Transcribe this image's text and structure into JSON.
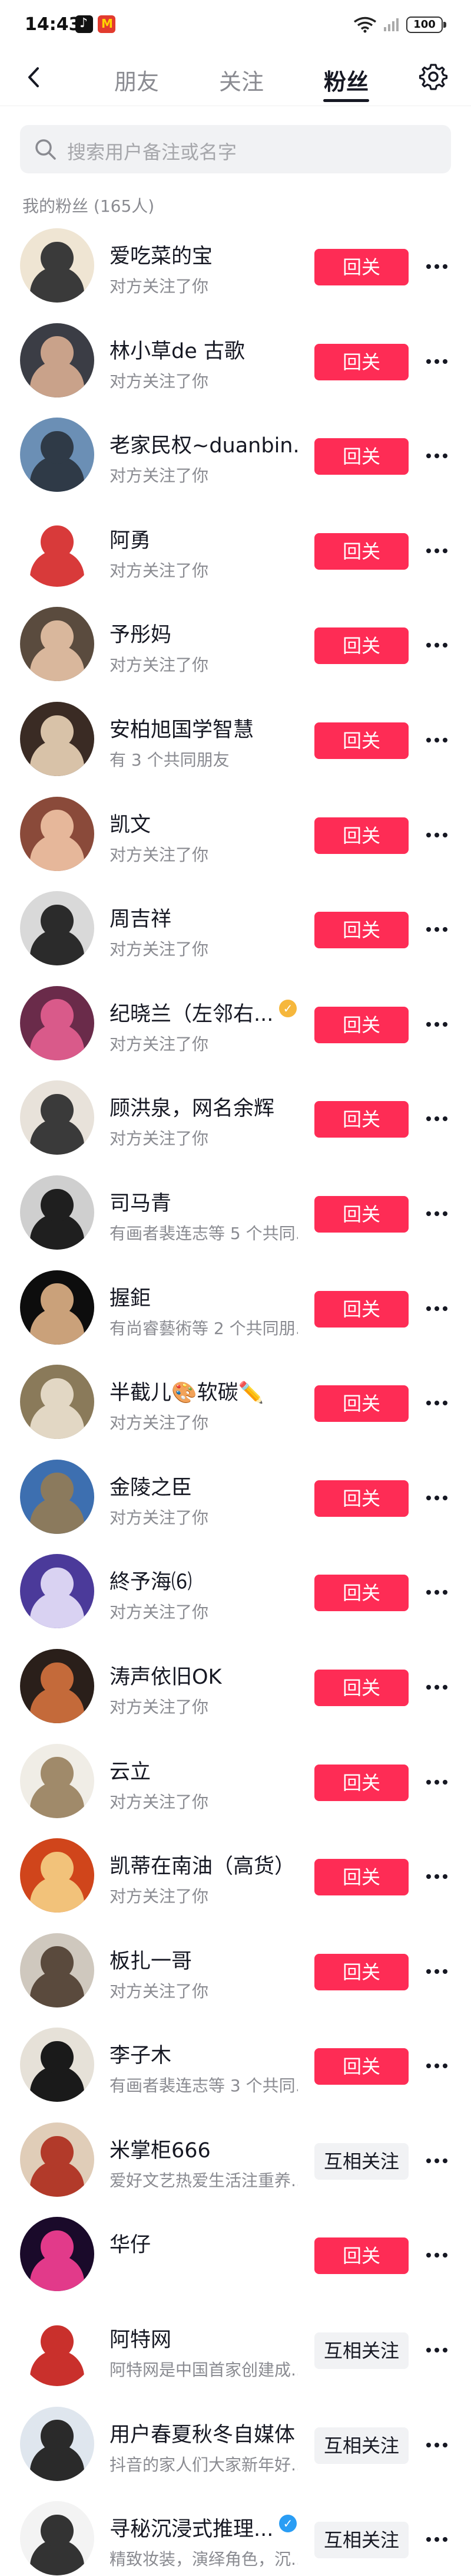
{
  "status_bar": {
    "time": "14:43",
    "battery": "100"
  },
  "nav": {
    "tabs": [
      {
        "label": "朋友",
        "active": false
      },
      {
        "label": "关注",
        "active": false
      },
      {
        "label": "粉丝",
        "active": true
      }
    ]
  },
  "search": {
    "placeholder": "搜索用户备注或名字"
  },
  "section": {
    "title": "我的粉丝 (165人)"
  },
  "colors": {
    "accent": "#fe2c55",
    "verified_gold": "#f6b73c",
    "verified_blue": "#2a9df4"
  },
  "fans": [
    {
      "name": "爱吃菜的宝",
      "subtitle": "对方关注了你",
      "action": "回关",
      "verified": null,
      "avatar": [
        "#efe5d3",
        "#3a3a3a"
      ]
    },
    {
      "name": "林小草de 古歌",
      "subtitle": "对方关注了你",
      "action": "回关",
      "verified": null,
      "avatar": [
        "#3b3d45",
        "#c9a28a"
      ]
    },
    {
      "name": "老家民权~duanbin...",
      "subtitle": "对方关注了你",
      "action": "回关",
      "verified": null,
      "avatar": [
        "#6b8fb5",
        "#2f3a47"
      ]
    },
    {
      "name": "阿勇",
      "subtitle": "对方关注了你",
      "action": "回关",
      "verified": null,
      "avatar": [
        "#ffffff",
        "#d83a3a"
      ]
    },
    {
      "name": "予彤妈",
      "subtitle": "对方关注了你",
      "action": "回关",
      "verified": null,
      "avatar": [
        "#5a4b3e",
        "#d9b79c"
      ]
    },
    {
      "name": "安柏旭国学智慧",
      "subtitle": "有 3 个共同朋友",
      "action": "回关",
      "verified": null,
      "avatar": [
        "#3a2b24",
        "#d8c2a8"
      ]
    },
    {
      "name": "凯文",
      "subtitle": "对方关注了你",
      "action": "回关",
      "verified": null,
      "avatar": [
        "#8a4a3a",
        "#e6b79a"
      ]
    },
    {
      "name": "周吉祥",
      "subtitle": "对方关注了你",
      "action": "回关",
      "verified": null,
      "avatar": [
        "#d9d9d9",
        "#2b2b2b"
      ]
    },
    {
      "name": "纪晓兰（左邻右...",
      "subtitle": "对方关注了你",
      "action": "回关",
      "verified": "gold",
      "avatar": [
        "#6a2b4a",
        "#d95a8a"
      ]
    },
    {
      "name": "顾洪泉，网名余辉",
      "subtitle": "对方关注了你",
      "action": "回关",
      "verified": null,
      "avatar": [
        "#e8e2da",
        "#3a3a3a"
      ]
    },
    {
      "name": "司马青",
      "subtitle": "有画者裴连志等 5 个共同...",
      "action": "回关",
      "verified": null,
      "avatar": [
        "#cfcfcf",
        "#1f1f1f"
      ]
    },
    {
      "name": "握鉅",
      "subtitle": "有尚睿藝術等 2 个共同朋...",
      "action": "回关",
      "verified": null,
      "avatar": [
        "#0d0d0d",
        "#caa17a"
      ]
    },
    {
      "name": "半截儿🎨软碳✏️",
      "subtitle": "对方关注了你",
      "action": "回关",
      "verified": null,
      "avatar": [
        "#8a7a5a",
        "#e2d7c4"
      ]
    },
    {
      "name": "金陵之臣",
      "subtitle": "对方关注了你",
      "action": "回关",
      "verified": null,
      "avatar": [
        "#3d6fb0",
        "#8b7a5d"
      ]
    },
    {
      "name": "終予海⑹",
      "subtitle": "对方关注了你",
      "action": "回关",
      "verified": null,
      "avatar": [
        "#4b3a9a",
        "#d9d2f2"
      ]
    },
    {
      "name": "涛声依旧OK",
      "subtitle": "对方关注了你",
      "action": "回关",
      "verified": null,
      "avatar": [
        "#2a1f1a",
        "#c46a3a"
      ]
    },
    {
      "name": "云立",
      "subtitle": "对方关注了你",
      "action": "回关",
      "verified": null,
      "avatar": [
        "#f0ede6",
        "#a08a6a"
      ]
    },
    {
      "name": "凯蒂在南油（高货）",
      "subtitle": "对方关注了你",
      "action": "回关",
      "verified": null,
      "avatar": [
        "#d0451b",
        "#f2c27a"
      ]
    },
    {
      "name": "板扎一哥",
      "subtitle": "对方关注了你",
      "action": "回关",
      "verified": null,
      "avatar": [
        "#cfc8be",
        "#5a4a3d"
      ]
    },
    {
      "name": "李子木",
      "subtitle": "有画者裴连志等 3 个共同...",
      "action": "回关",
      "verified": null,
      "avatar": [
        "#e6e1d8",
        "#1a1a1a"
      ]
    },
    {
      "name": "米掌柜666",
      "subtitle": "爱好文艺热爱生活注重养...",
      "action": "互相关注",
      "verified": null,
      "avatar": [
        "#e0cdb8",
        "#b23a2a"
      ]
    },
    {
      "name": "华仔",
      "subtitle": "",
      "action": "回关",
      "verified": null,
      "avatar": [
        "#1a0a2a",
        "#e23a8a"
      ]
    },
    {
      "name": "阿特网",
      "subtitle": "阿特网是中国首家创建成...",
      "action": "互相关注",
      "verified": null,
      "avatar": [
        "#ffffff",
        "#c9302c"
      ]
    },
    {
      "name": "用户春夏秋冬自媒体",
      "subtitle": "抖音的家人们大家新年好...",
      "action": "互相关注",
      "verified": null,
      "avatar": [
        "#dfe6ee",
        "#2a2a2a"
      ]
    },
    {
      "name": "寻秘沉浸式推理...",
      "subtitle": "精致妆装，演绎角色，沉...",
      "action": "互相关注",
      "verified": "blue",
      "avatar": [
        "#f3f3f3",
        "#333333"
      ]
    }
  ]
}
